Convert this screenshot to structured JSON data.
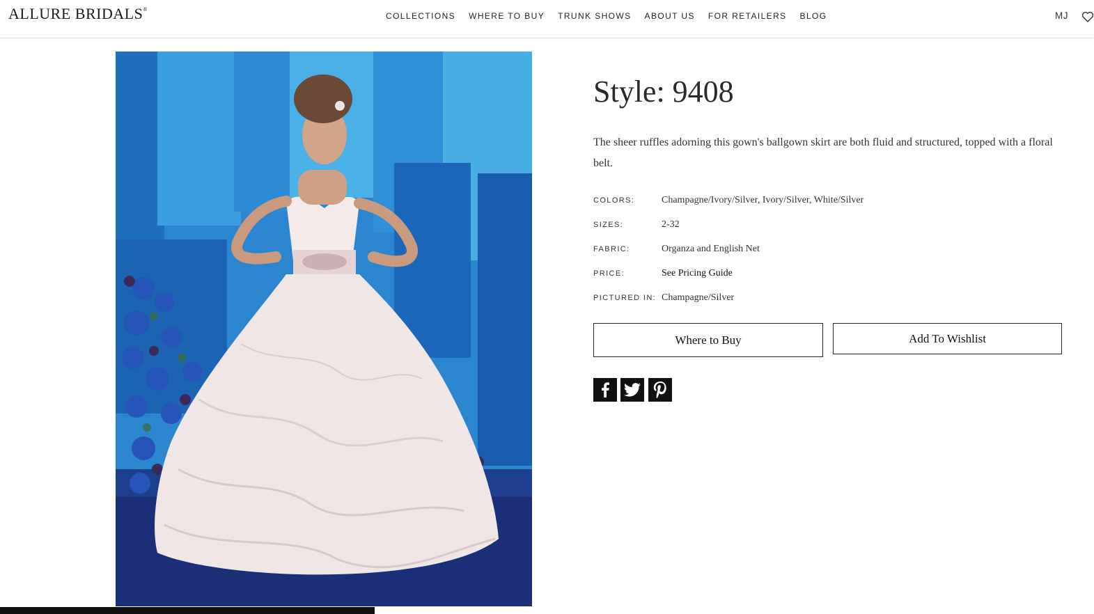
{
  "brand": {
    "logo": "Allure Bridals"
  },
  "nav": {
    "items": [
      "COLLECTIONS",
      "WHERE TO BUY",
      "TRUNK SHOWS",
      "ABOUT US",
      "FOR RETAILERS",
      "BLOG"
    ],
    "user_initials": "MJ"
  },
  "product": {
    "title": "Style: 9408",
    "description": "The sheer ruffles adorning this gown's ballgown skirt are both fluid and structured, topped with a floral belt.",
    "specs": [
      {
        "label": "COLORS:",
        "value": "Champagne/Ivory/Silver, Ivory/Silver, White/Silver"
      },
      {
        "label": "SIZES:",
        "value": "2-32"
      },
      {
        "label": "FABRIC:",
        "value": "Organza and English Net"
      },
      {
        "label": "PRICE:",
        "value": "See Pricing Guide"
      },
      {
        "label": "PICTURED IN:",
        "value": "Champagne/Silver"
      }
    ],
    "buttons": {
      "where_to_buy": "Where to Buy",
      "wishlist": "Add To Wishlist"
    },
    "social": [
      "facebook-icon",
      "twitter-icon",
      "pinterest-icon"
    ]
  },
  "status_bar": {
    "text": ""
  },
  "colors": {
    "text": "#222222",
    "border": "#222222",
    "social_bg": "#111111"
  }
}
